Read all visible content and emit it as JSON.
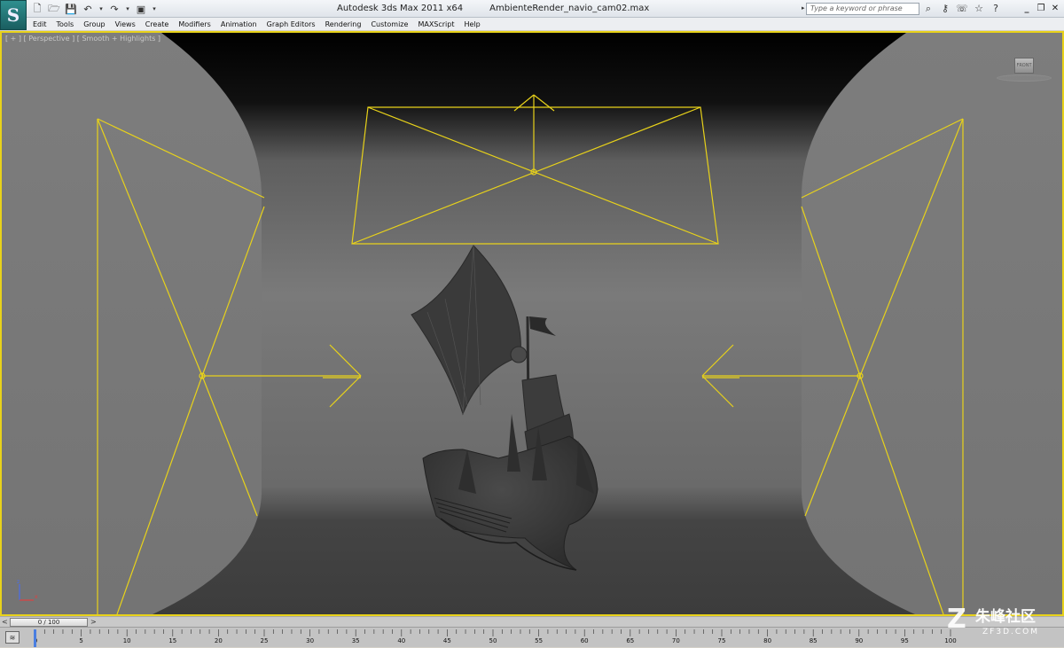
{
  "titlebar": {
    "logo": "S",
    "app_name": "Autodesk 3ds Max  2011 x64",
    "file_name": "AmbienteRender_navio_cam02.max",
    "search_placeholder": "Type a keyword or phrase",
    "qa_icons": [
      "new-file-icon",
      "open-folder-icon",
      "save-icon",
      "undo-icon",
      "redo-icon",
      "project-icon"
    ],
    "infocenter_icons": [
      "binoculars-icon",
      "subscription-key-icon",
      "comm-center-icon",
      "favorites-star-icon",
      "help-icon"
    ]
  },
  "menu": {
    "items": [
      "Edit",
      "Tools",
      "Group",
      "Views",
      "Create",
      "Modifiers",
      "Animation",
      "Graph Editors",
      "Rendering",
      "Customize",
      "MAXScript",
      "Help"
    ]
  },
  "viewport": {
    "label": "[ + ] [ Perspective ] [ Smooth + Highlights ]",
    "viewcube_label": "FRONT",
    "accent_color": "#e8d21a",
    "axis": {
      "z": "z",
      "x": "x"
    }
  },
  "timeslider": {
    "value": "0 / 100",
    "left_arrow": "<",
    "right_arrow": ">"
  },
  "trackbar": {
    "ticks": [
      "0",
      "5",
      "10",
      "15",
      "20",
      "25",
      "30",
      "35",
      "40",
      "45",
      "50",
      "55",
      "60",
      "65",
      "70",
      "75",
      "80",
      "85",
      "90",
      "95",
      "100"
    ]
  },
  "watermark": {
    "logo": "Z",
    "cn_text": "朱峰社区",
    "url": "ZF3D.COM"
  }
}
